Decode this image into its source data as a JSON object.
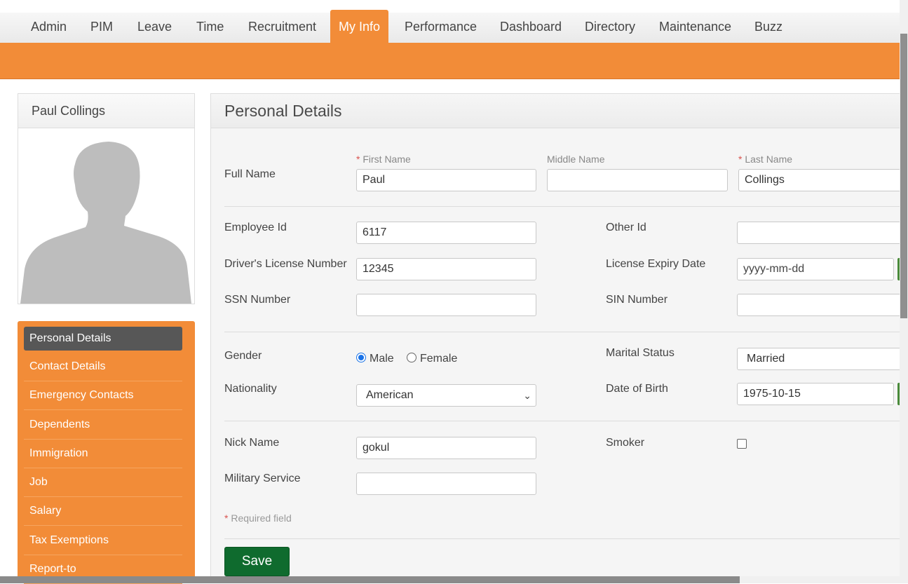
{
  "nav": {
    "items": [
      "Admin",
      "PIM",
      "Leave",
      "Time",
      "Recruitment",
      "My Info",
      "Performance",
      "Dashboard",
      "Directory",
      "Maintenance",
      "Buzz"
    ],
    "active": "My Info"
  },
  "profile": {
    "name": "Paul Collings"
  },
  "sidemenu": {
    "items": [
      "Personal Details",
      "Contact Details",
      "Emergency Contacts",
      "Dependents",
      "Immigration",
      "Job",
      "Salary",
      "Tax Exemptions",
      "Report-to"
    ],
    "active": "Personal Details"
  },
  "panel": {
    "title": "Personal Details",
    "full_name_label": "Full Name",
    "first_name_label": "First Name",
    "middle_name_label": "Middle Name",
    "last_name_label": "Last Name",
    "required_marker": "*",
    "first_name": "Paul",
    "middle_name": "",
    "last_name": "Collings",
    "employee_id_label": "Employee Id",
    "employee_id": "6117",
    "other_id_label": "Other Id",
    "other_id": "",
    "license_label": "Driver's License Number",
    "license": "12345",
    "license_expiry_label": "License Expiry Date",
    "license_expiry_placeholder": "yyyy-mm-dd",
    "ssn_label": "SSN Number",
    "ssn": "",
    "sin_label": "SIN Number",
    "sin": "",
    "gender_label": "Gender",
    "gender_male": "Male",
    "gender_female": "Female",
    "gender_selected": "Male",
    "marital_label": "Marital Status",
    "marital": "Married",
    "nationality_label": "Nationality",
    "nationality": "American",
    "dob_label": "Date of Birth",
    "dob": "1975-10-15",
    "nick_label": "Nick Name",
    "nick": "gokul",
    "smoker_label": "Smoker",
    "smoker": false,
    "military_label": "Military Service",
    "military": "",
    "required_note": "Required field",
    "save_label": "Save"
  },
  "colors": {
    "accent": "#f28c38",
    "save": "#0f6b2e",
    "menu_active": "#575757"
  }
}
